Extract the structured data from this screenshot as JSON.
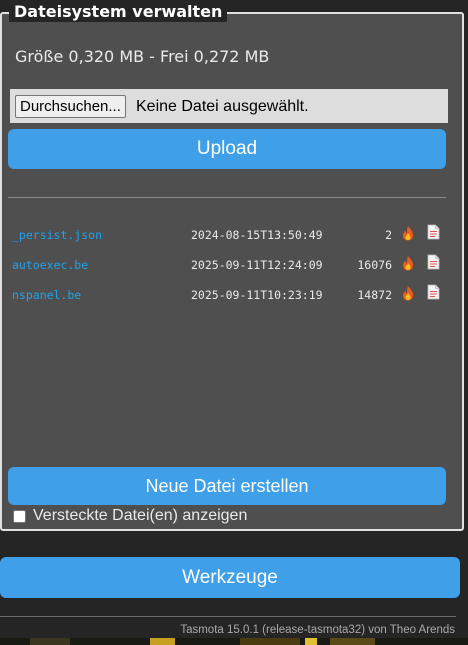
{
  "legend": "Dateisystem verwalten",
  "size_info": "Größe 0,320 MB - Frei 0,272 MB",
  "upload": {
    "browse_label": "Durchsuchen...",
    "no_file_label": "Keine Datei ausgewählt.",
    "button_label": "Upload"
  },
  "files": [
    {
      "name": "_persist.json",
      "date": "2024-08-15T13:50:49",
      "size": "2"
    },
    {
      "name": "autoexec.be",
      "date": "2025-09-11T12:24:09",
      "size": "16076"
    },
    {
      "name": "nspanel.be",
      "date": "2025-09-11T10:23:19",
      "size": "14872"
    }
  ],
  "icons": {
    "delete": "fire-icon",
    "edit": "document-icon"
  },
  "new_file_label": "Neue Datei erstellen",
  "show_hidden_label": "Versteckte Datei(en) anzeigen",
  "tools_label": "Werkzeuge",
  "footer": "Tasmota 15.0.1 (release-tasmota32) von Theo Arends",
  "colors": {
    "accent": "#3f9fe8",
    "link": "#1fa3ec",
    "panel": "#4f4f4f",
    "background": "#252525"
  }
}
